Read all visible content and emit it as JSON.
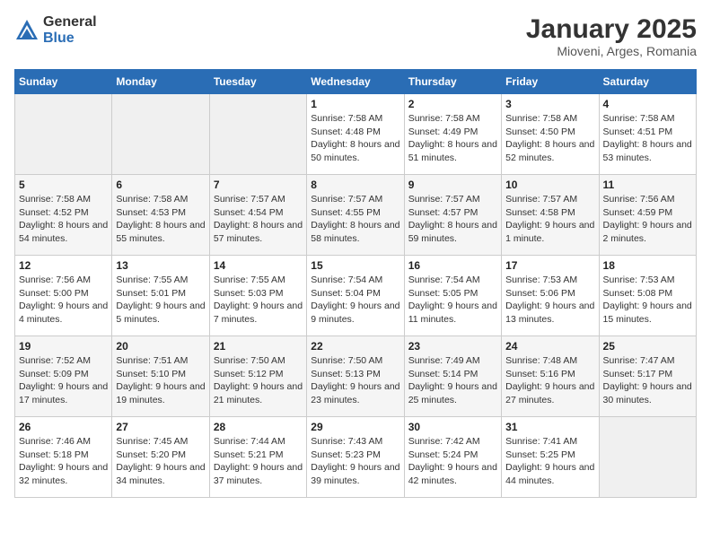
{
  "header": {
    "logo_general": "General",
    "logo_blue": "Blue",
    "title": "January 2025",
    "subtitle": "Mioveni, Arges, Romania"
  },
  "weekdays": [
    "Sunday",
    "Monday",
    "Tuesday",
    "Wednesday",
    "Thursday",
    "Friday",
    "Saturday"
  ],
  "weeks": [
    [
      {
        "day": "",
        "sunrise": "",
        "sunset": "",
        "daylight": "",
        "empty": true
      },
      {
        "day": "",
        "sunrise": "",
        "sunset": "",
        "daylight": "",
        "empty": true
      },
      {
        "day": "",
        "sunrise": "",
        "sunset": "",
        "daylight": "",
        "empty": true
      },
      {
        "day": "1",
        "sunrise": "Sunrise: 7:58 AM",
        "sunset": "Sunset: 4:48 PM",
        "daylight": "Daylight: 8 hours and 50 minutes."
      },
      {
        "day": "2",
        "sunrise": "Sunrise: 7:58 AM",
        "sunset": "Sunset: 4:49 PM",
        "daylight": "Daylight: 8 hours and 51 minutes."
      },
      {
        "day": "3",
        "sunrise": "Sunrise: 7:58 AM",
        "sunset": "Sunset: 4:50 PM",
        "daylight": "Daylight: 8 hours and 52 minutes."
      },
      {
        "day": "4",
        "sunrise": "Sunrise: 7:58 AM",
        "sunset": "Sunset: 4:51 PM",
        "daylight": "Daylight: 8 hours and 53 minutes."
      }
    ],
    [
      {
        "day": "5",
        "sunrise": "Sunrise: 7:58 AM",
        "sunset": "Sunset: 4:52 PM",
        "daylight": "Daylight: 8 hours and 54 minutes."
      },
      {
        "day": "6",
        "sunrise": "Sunrise: 7:58 AM",
        "sunset": "Sunset: 4:53 PM",
        "daylight": "Daylight: 8 hours and 55 minutes."
      },
      {
        "day": "7",
        "sunrise": "Sunrise: 7:57 AM",
        "sunset": "Sunset: 4:54 PM",
        "daylight": "Daylight: 8 hours and 57 minutes."
      },
      {
        "day": "8",
        "sunrise": "Sunrise: 7:57 AM",
        "sunset": "Sunset: 4:55 PM",
        "daylight": "Daylight: 8 hours and 58 minutes."
      },
      {
        "day": "9",
        "sunrise": "Sunrise: 7:57 AM",
        "sunset": "Sunset: 4:57 PM",
        "daylight": "Daylight: 8 hours and 59 minutes."
      },
      {
        "day": "10",
        "sunrise": "Sunrise: 7:57 AM",
        "sunset": "Sunset: 4:58 PM",
        "daylight": "Daylight: 9 hours and 1 minute."
      },
      {
        "day": "11",
        "sunrise": "Sunrise: 7:56 AM",
        "sunset": "Sunset: 4:59 PM",
        "daylight": "Daylight: 9 hours and 2 minutes."
      }
    ],
    [
      {
        "day": "12",
        "sunrise": "Sunrise: 7:56 AM",
        "sunset": "Sunset: 5:00 PM",
        "daylight": "Daylight: 9 hours and 4 minutes."
      },
      {
        "day": "13",
        "sunrise": "Sunrise: 7:55 AM",
        "sunset": "Sunset: 5:01 PM",
        "daylight": "Daylight: 9 hours and 5 minutes."
      },
      {
        "day": "14",
        "sunrise": "Sunrise: 7:55 AM",
        "sunset": "Sunset: 5:03 PM",
        "daylight": "Daylight: 9 hours and 7 minutes."
      },
      {
        "day": "15",
        "sunrise": "Sunrise: 7:54 AM",
        "sunset": "Sunset: 5:04 PM",
        "daylight": "Daylight: 9 hours and 9 minutes."
      },
      {
        "day": "16",
        "sunrise": "Sunrise: 7:54 AM",
        "sunset": "Sunset: 5:05 PM",
        "daylight": "Daylight: 9 hours and 11 minutes."
      },
      {
        "day": "17",
        "sunrise": "Sunrise: 7:53 AM",
        "sunset": "Sunset: 5:06 PM",
        "daylight": "Daylight: 9 hours and 13 minutes."
      },
      {
        "day": "18",
        "sunrise": "Sunrise: 7:53 AM",
        "sunset": "Sunset: 5:08 PM",
        "daylight": "Daylight: 9 hours and 15 minutes."
      }
    ],
    [
      {
        "day": "19",
        "sunrise": "Sunrise: 7:52 AM",
        "sunset": "Sunset: 5:09 PM",
        "daylight": "Daylight: 9 hours and 17 minutes."
      },
      {
        "day": "20",
        "sunrise": "Sunrise: 7:51 AM",
        "sunset": "Sunset: 5:10 PM",
        "daylight": "Daylight: 9 hours and 19 minutes."
      },
      {
        "day": "21",
        "sunrise": "Sunrise: 7:50 AM",
        "sunset": "Sunset: 5:12 PM",
        "daylight": "Daylight: 9 hours and 21 minutes."
      },
      {
        "day": "22",
        "sunrise": "Sunrise: 7:50 AM",
        "sunset": "Sunset: 5:13 PM",
        "daylight": "Daylight: 9 hours and 23 minutes."
      },
      {
        "day": "23",
        "sunrise": "Sunrise: 7:49 AM",
        "sunset": "Sunset: 5:14 PM",
        "daylight": "Daylight: 9 hours and 25 minutes."
      },
      {
        "day": "24",
        "sunrise": "Sunrise: 7:48 AM",
        "sunset": "Sunset: 5:16 PM",
        "daylight": "Daylight: 9 hours and 27 minutes."
      },
      {
        "day": "25",
        "sunrise": "Sunrise: 7:47 AM",
        "sunset": "Sunset: 5:17 PM",
        "daylight": "Daylight: 9 hours and 30 minutes."
      }
    ],
    [
      {
        "day": "26",
        "sunrise": "Sunrise: 7:46 AM",
        "sunset": "Sunset: 5:18 PM",
        "daylight": "Daylight: 9 hours and 32 minutes."
      },
      {
        "day": "27",
        "sunrise": "Sunrise: 7:45 AM",
        "sunset": "Sunset: 5:20 PM",
        "daylight": "Daylight: 9 hours and 34 minutes."
      },
      {
        "day": "28",
        "sunrise": "Sunrise: 7:44 AM",
        "sunset": "Sunset: 5:21 PM",
        "daylight": "Daylight: 9 hours and 37 minutes."
      },
      {
        "day": "29",
        "sunrise": "Sunrise: 7:43 AM",
        "sunset": "Sunset: 5:23 PM",
        "daylight": "Daylight: 9 hours and 39 minutes."
      },
      {
        "day": "30",
        "sunrise": "Sunrise: 7:42 AM",
        "sunset": "Sunset: 5:24 PM",
        "daylight": "Daylight: 9 hours and 42 minutes."
      },
      {
        "day": "31",
        "sunrise": "Sunrise: 7:41 AM",
        "sunset": "Sunset: 5:25 PM",
        "daylight": "Daylight: 9 hours and 44 minutes."
      },
      {
        "day": "",
        "sunrise": "",
        "sunset": "",
        "daylight": "",
        "empty": true
      }
    ]
  ]
}
